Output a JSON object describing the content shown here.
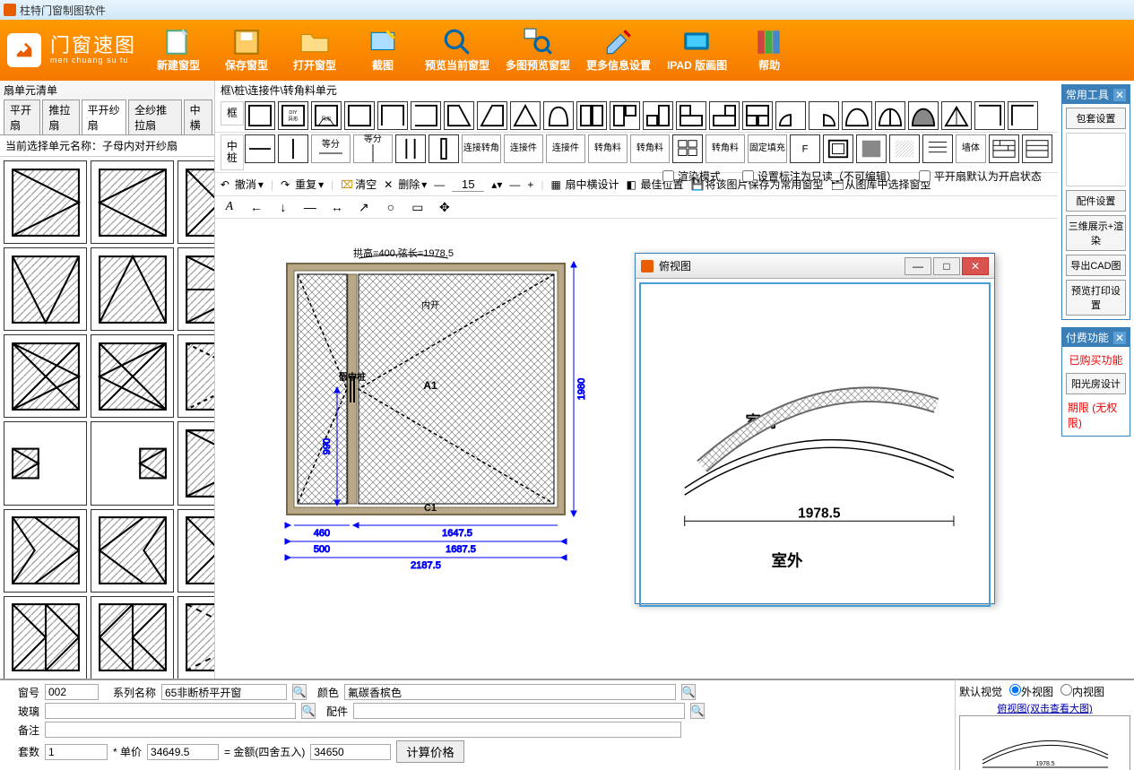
{
  "app": {
    "title": "柱特门窗制图软件"
  },
  "logo": {
    "name": "门窗速图",
    "sub": "men chuang su tu"
  },
  "toolbar": {
    "new": "新建窗型",
    "save": "保存窗型",
    "open": "打开窗型",
    "screenshot": "截图",
    "preview_current": "预览当前窗型",
    "preview_multi": "多图预览窗型",
    "more_settings": "更多信息设置",
    "ipad": "IPAD 版画图",
    "help": "帮助"
  },
  "left": {
    "header": "扇单元清单",
    "tabs": [
      "平开扇",
      "推拉扇",
      "平开纱扇",
      "全纱推拉扇",
      "中横"
    ],
    "active_tab": 2,
    "current_selection_label": "当前选择单元名称：",
    "current_selection_value": "子母内对开纱扇"
  },
  "breadcrumb": "框\\桩\\连接件\\转角料单元",
  "shape_groups": {
    "frame": "框",
    "mid": "中桩"
  },
  "mid_labels": {
    "equal": "等分",
    "dbl_equal": "等分",
    "connect": "连接转角",
    "conn_item": "连接件",
    "corner": "转角料",
    "corner_item": "转角料",
    "fixed": "固定填充",
    "wall": "墙体"
  },
  "actions": {
    "undo": "撤消",
    "redo": "重复",
    "clear": "清空",
    "delete": "删除",
    "spin_value": "15",
    "sash_design": "扇中横设计",
    "best_pos": "最佳位置",
    "save_as_common": "将该图片保存为常用窗型",
    "from_lib": "从图库中选择窗型"
  },
  "anno_letter": "A",
  "checks": {
    "render": "渲染模式",
    "readonly": "设置标注为只读（不可编辑）",
    "open_state": "平开扇默认为开启状态"
  },
  "drawing": {
    "arch_note": "拱高=400,弦长=1978.5",
    "label_a": "A1",
    "label_c": "C1",
    "mid_label": "假中桩",
    "inside": "内开",
    "h": "1980",
    "h_inner": "990",
    "w1": "460",
    "w2": "1647.5",
    "w3": "500",
    "w4": "1687.5",
    "w_total": "2187.5"
  },
  "overview": {
    "title": "俯视图",
    "inside": "室内",
    "outside": "室外",
    "span": "1978.5"
  },
  "right": {
    "tools_title": "常用工具",
    "tools_x": "✕",
    "btn_cover": "包套设置",
    "btn_parts": "配件设置",
    "btn_3d": "三维展示+渲染",
    "btn_cad": "导出CAD图",
    "btn_print": "预览打印设置",
    "paid_title": "付费功能",
    "paid_bought": "已购买功能",
    "btn_sunroom": "阳光房设计",
    "term": "期限 (无权限)"
  },
  "bottom": {
    "win_no_lbl": "窗号",
    "win_no": "002",
    "series_lbl": "系列名称",
    "series": "65非断桥平开窗",
    "color_lbl": "颜色",
    "color": "氟碳香槟色",
    "glass_lbl": "玻璃",
    "glass": "",
    "parts_lbl": "配件",
    "parts": "",
    "remark_lbl": "备注",
    "remark": "",
    "qty_lbl": "套数",
    "qty": "1",
    "unit_lbl": "* 单价",
    "unit": "34649.5",
    "total_lbl": "= 金额(四舍五入)",
    "total": "34650",
    "calc_btn": "计算价格",
    "view_default": "默认视觉",
    "view_out": "外视图",
    "view_in": "内视图",
    "preview_lbl": "俯视图(双击查看大图)"
  }
}
